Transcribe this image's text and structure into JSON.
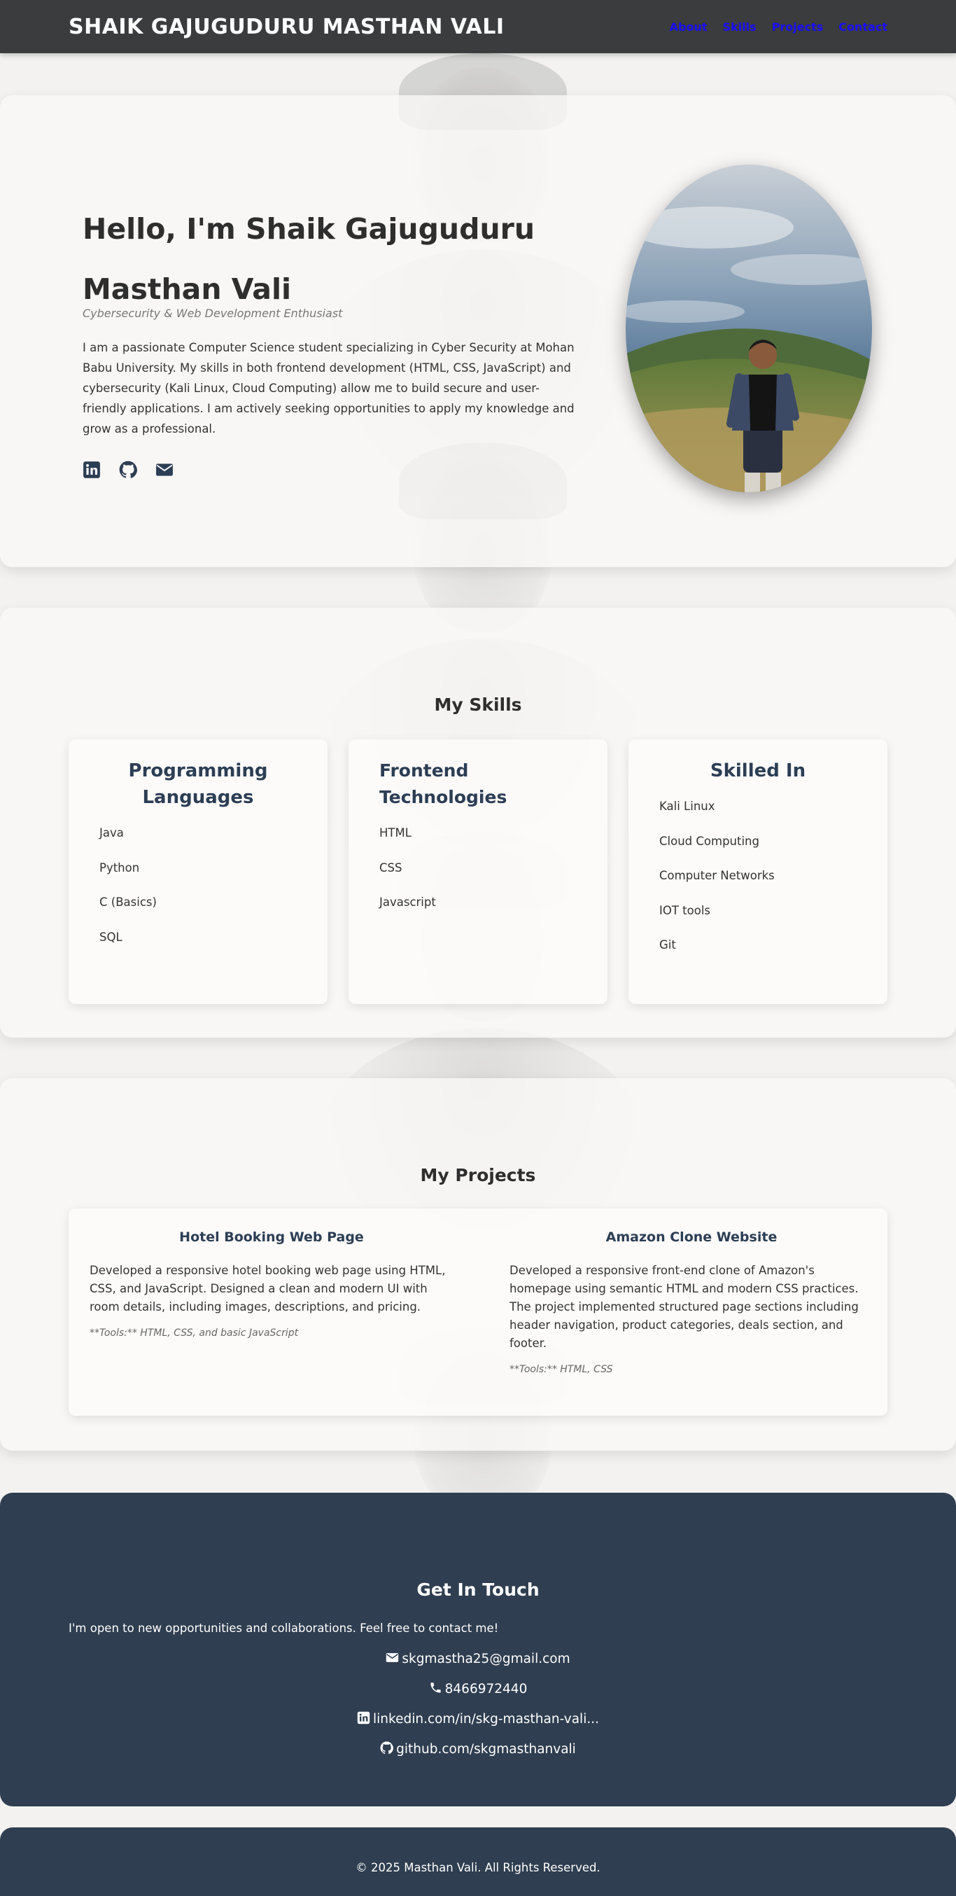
{
  "header": {
    "brand": "SHAIK GAJUGUDURU MASTHAN VALI",
    "nav": [
      "About",
      "Skills",
      "Projects",
      "Contact"
    ]
  },
  "hero": {
    "title": "Hello, I'm Shaik Gajuguduru Masthan Vali",
    "subtitle": "Cybersecurity & Web Development Enthusiast",
    "about": "I am a passionate Computer Science student specializing in Cyber Security at Mohan Babu University. My skills in both frontend development (HTML, CSS, JavaScript) and cybersecurity (Kali Linux, Cloud Computing) allow me to build secure and user-friendly applications. I am actively seeking opportunities to apply my knowledge and grow as a professional.",
    "social_icons": [
      "linkedin-icon",
      "github-icon",
      "envelope-icon"
    ],
    "photo": "profile-photo"
  },
  "skills": {
    "title": "My Skills",
    "cards": [
      {
        "title": "Programming Languages",
        "items": [
          "Java",
          "Python",
          "C (Basics)",
          "SQL"
        ]
      },
      {
        "title": "Frontend Technologies",
        "items": [
          "HTML",
          "CSS",
          "Javascript"
        ]
      },
      {
        "title": "Skilled In",
        "items": [
          "Kali Linux",
          "Cloud Computing",
          "Computer Networks",
          "IOT tools",
          "Git"
        ]
      }
    ]
  },
  "projects": {
    "title": "My Projects",
    "items": [
      {
        "title": "Hotel Booking Web Page",
        "description": "Developed a responsive hotel booking web page using HTML, CSS, and JavaScript. Designed a clean and modern UI with room details, including images, descriptions, and pricing.",
        "tools": "**Tools:** HTML, CSS, and basic JavaScript"
      },
      {
        "title": "Amazon Clone Website",
        "description": "Developed a responsive front-end clone of Amazon's homepage using semantic HTML and modern CSS practices. The project implemented structured page sections including header navigation, product categories, deals section, and footer.",
        "tools": "**Tools:** HTML, CSS"
      }
    ]
  },
  "contact": {
    "title": "Get In Touch",
    "intro": "I'm open to new opportunities and collaborations. Feel free to contact me!",
    "email": "skgmastha25@gmail.com",
    "phone": "8466972440",
    "linkedin": "linkedin.com/in/skg-masthan-vali...",
    "github": "github.com/skgmasthanvali"
  },
  "footer": {
    "text": "© 2025 Masthan Vali. All Rights Reserved."
  },
  "colors": {
    "header_bg": "#3a3c3e",
    "nav_link": "#1a0dff",
    "heading_navy": "#2c3e54",
    "contact_bg": "#2f3e50"
  }
}
